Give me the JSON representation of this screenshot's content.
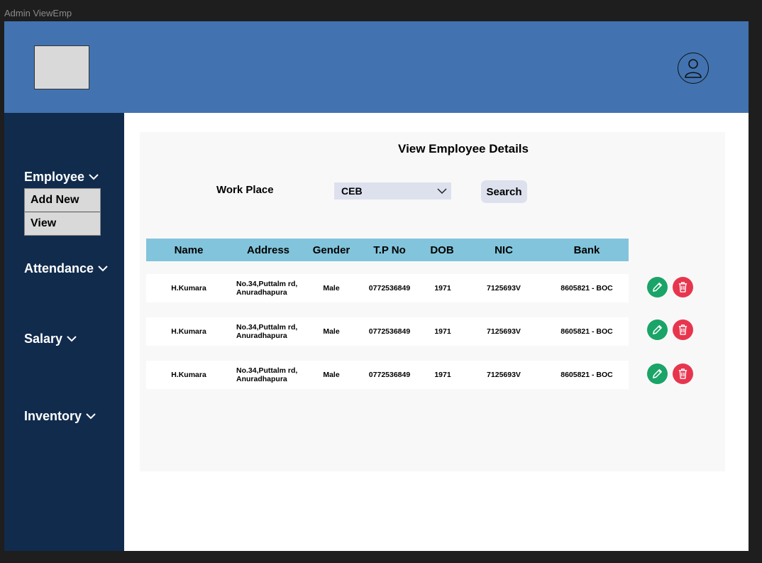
{
  "window": {
    "title": "Admin ViewEmp"
  },
  "header": {
    "logo": "logo-placeholder",
    "avatar_icon": "user-avatar-icon"
  },
  "sidebar": {
    "employee": {
      "label": "Employee",
      "submenu": [
        {
          "label": "Add New"
        },
        {
          "label": "View"
        }
      ]
    },
    "attendance": {
      "label": "Attendance"
    },
    "salary": {
      "label": "Salary"
    },
    "inventory": {
      "label": "Inventory"
    }
  },
  "main": {
    "title": "View Employee Details",
    "filter": {
      "label": "Work Place",
      "selected": "CEB",
      "search_label": "Search"
    },
    "table": {
      "columns": [
        "Name",
        "Address",
        "Gender",
        "T.P No",
        "DOB",
        "NIC",
        "Bank"
      ],
      "rows": [
        {
          "name": "H.Kumara",
          "address_line1": "No.34,Puttalm rd,",
          "address_line2": "Anuradhapura",
          "gender": "Male",
          "tp": "0772536849",
          "dob": "1971",
          "nic": "7125693V",
          "bank": "8605821 - BOC"
        },
        {
          "name": "H.Kumara",
          "address_line1": "No.34,Puttalm rd,",
          "address_line2": "Anuradhapura",
          "gender": "Male",
          "tp": "0772536849",
          "dob": "1971",
          "nic": "7125693V",
          "bank": "8605821 - BOC"
        },
        {
          "name": "H.Kumara",
          "address_line1": "No.34,Puttalm rd,",
          "address_line2": "Anuradhapura",
          "gender": "Male",
          "tp": "0772536849",
          "dob": "1971",
          "nic": "7125693V",
          "bank": "8605821 - BOC"
        }
      ],
      "row_actions": {
        "edit_icon": "pencil-icon",
        "delete_icon": "trash-icon"
      }
    }
  },
  "colors": {
    "header": "#4273b0",
    "sidebar": "#112b4d",
    "table_header": "#82c4db",
    "edit": "#1aa468",
    "delete": "#e8354e"
  }
}
